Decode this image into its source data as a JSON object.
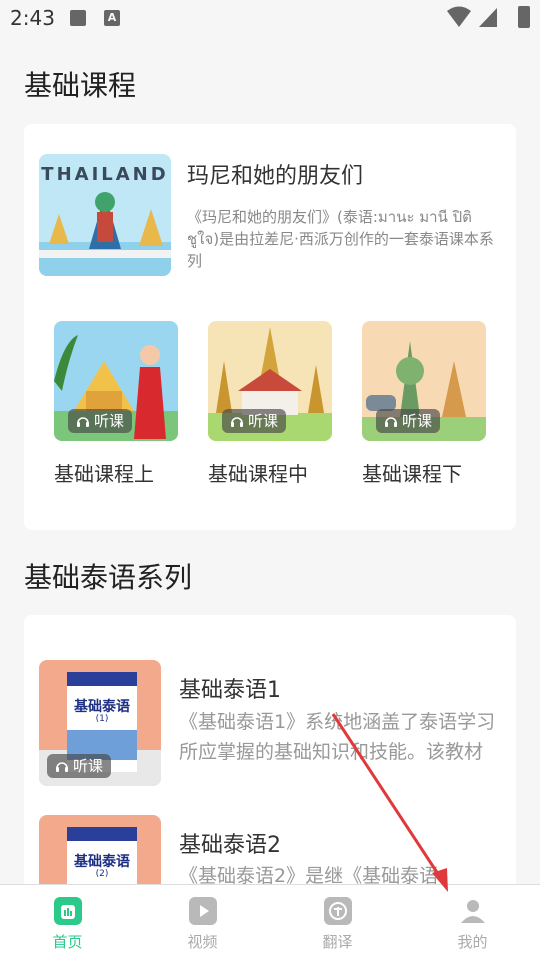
{
  "status_bar": {
    "time": "2:43",
    "a_badge": "A"
  },
  "sections": {
    "basic_course_title": "基础课程",
    "series_title": "基础泰语系列"
  },
  "hero": {
    "image_text": "THAILAND",
    "title": "玛尼和她的朋友们",
    "description": "《玛尼和她的朋友们》(泰语:มานะ มานี ปิติ ชูใจ)是由拉差尼·西派万创作的一套泰语课本系列"
  },
  "courses": [
    {
      "label": "基础课程上",
      "listen": "听课"
    },
    {
      "label": "基础课程中",
      "listen": "听课"
    },
    {
      "label": "基础课程下",
      "listen": "听课"
    }
  ],
  "series": [
    {
      "title": "基础泰语1",
      "description": "《基础泰语1》系统地涵盖了泰语学习所应掌握的基础知识和技能。该教材",
      "listen": "听课",
      "cover_title": "基础泰语",
      "cover_num": "(1)"
    },
    {
      "title": "基础泰语2",
      "description": "《基础泰语2》是继《基础泰语",
      "cover_title": "基础泰语",
      "cover_num": "(2)"
    }
  ],
  "bottom_nav": [
    {
      "label": "首页",
      "icon": "home-icon",
      "active": true
    },
    {
      "label": "视频",
      "icon": "video-icon",
      "active": false
    },
    {
      "label": "翻译",
      "icon": "translate-icon",
      "active": false
    },
    {
      "label": "我的",
      "icon": "profile-icon",
      "active": false
    }
  ],
  "colors": {
    "accent": "#2bc98a",
    "annotation": "#e0393b"
  }
}
